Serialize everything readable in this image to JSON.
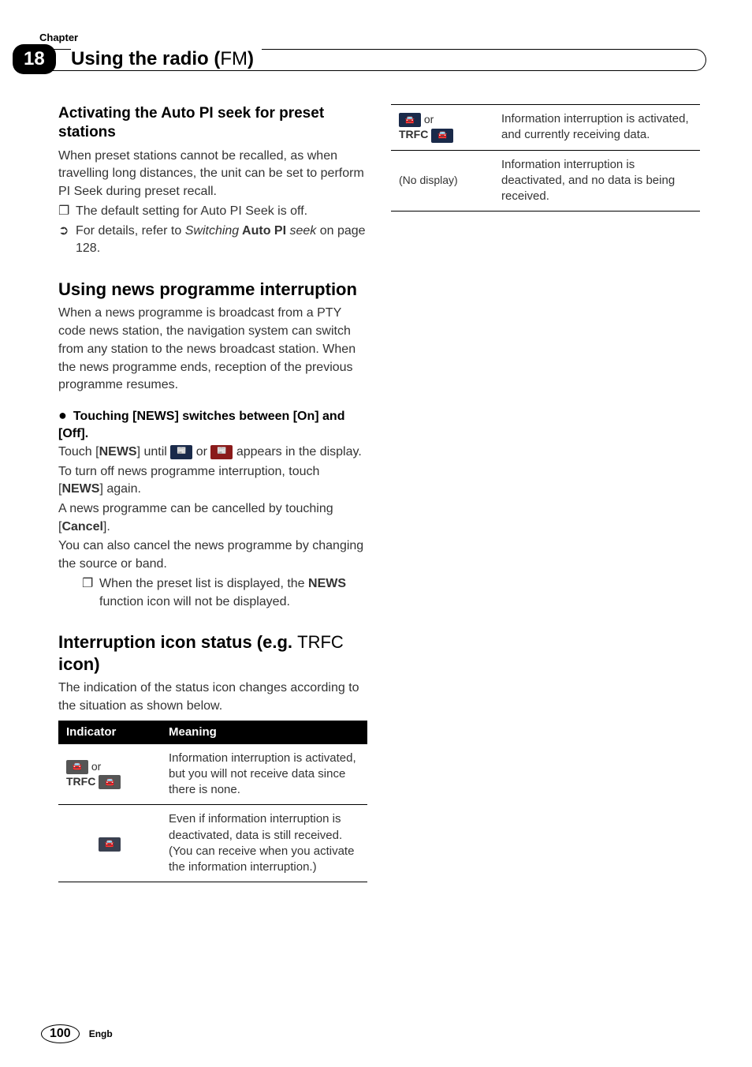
{
  "header": {
    "chapter_label": "Chapter",
    "chapter_number": "18",
    "title_main": "Using the radio (",
    "title_light": "FM",
    "title_close": ")"
  },
  "left": {
    "h1": "Activating the Auto PI seek for preset stations",
    "p1": "When preset stations cannot be recalled, as when travelling long distances, the unit can be set to perform PI Seek during preset recall.",
    "b1_mark": "❐",
    "b1": "The default setting for Auto PI Seek is off.",
    "b2_mark": "➲",
    "b2_pre": "For details, refer to ",
    "b2_italic1": "Switching",
    "b2_bold": " Auto PI ",
    "b2_italic2": "seek",
    "b2_post": " on page 128.",
    "h2": "Using news programme interruption",
    "p2": "When a news programme is broadcast from a PTY code news station, the navigation system can switch from any station to the news broadcast station. When the news programme ends, reception of the previous programme resumes.",
    "instr_head": "Touching [NEWS] switches between [On] and [Off].",
    "p3a": "Touch [",
    "p3a_bold": "NEWS",
    "p3a_mid": "] until ",
    "p3a_or": " or ",
    "p3a_end": " appears in the display.",
    "p4a": "To turn off news programme interruption, touch [",
    "p4a_bold": "NEWS",
    "p4a_end": "] again.",
    "p5a": "A news programme can be cancelled by touching [",
    "p5a_bold": "Cancel",
    "p5a_end": "].",
    "p6": "You can also cancel the news programme by changing the source or band.",
    "note_mark": "❐",
    "note_pre": "When the preset list is displayed, the ",
    "note_bold": "NEWS",
    "note_post": " function icon will not be displayed.",
    "h3_pre": "Interruption icon status (e.g. ",
    "h3_light": "TRFC",
    "h3_post": " icon)",
    "p7": "The indication of the status icon changes according to the situation as shown below.",
    "th1": "Indicator",
    "th2": "Meaning",
    "r1_or": " or",
    "r1_trfc": "TRFC ",
    "r1_meaning": "Information interruption is activated, but you will not receive data since there is none.",
    "r2_meaning": "Even if information interruption is deactivated, data is still received. (You can receive when you activate the information interruption.)"
  },
  "right": {
    "r3_or": " or",
    "r3_trfc": "TRFC ",
    "r3_meaning": "Information interruption is activated, and currently receiving data.",
    "r4_indicator": "(No display)",
    "r4_meaning": "Information interruption is deactivated, and no data is being received."
  },
  "footer": {
    "page": "100",
    "lang": "Engb"
  },
  "icons": {
    "news_blue": "📰",
    "news_red": "📰",
    "car_grey": "🚘",
    "car_dark": "🚘",
    "car_blue": "🚘"
  }
}
